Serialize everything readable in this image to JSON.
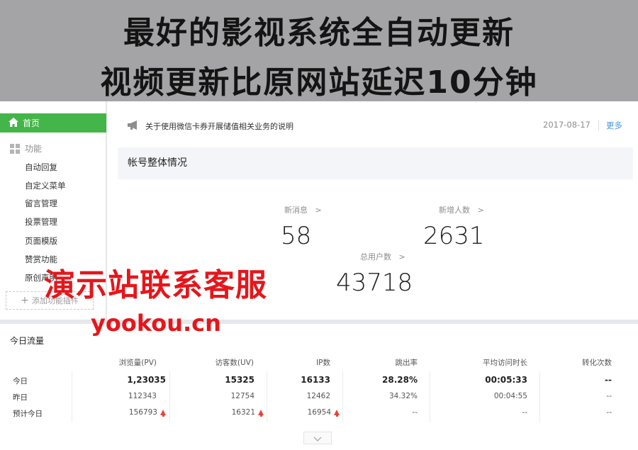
{
  "banner": {
    "line1": "最好的影视系统全自动更新",
    "line2": "视频更新比原网站延迟10分钟"
  },
  "sidebar": {
    "home_label": "首页",
    "section_label": "功能",
    "items": [
      "自动回复",
      "自定义菜单",
      "留言管理",
      "投票管理",
      "页面模版",
      "赞赏功能",
      "原创声明"
    ],
    "add_plugin_label": "添加功能插件"
  },
  "notice": {
    "text": "关于使用微信卡券开展储值相关业务的说明",
    "date": "2017-08-17",
    "more_label": "更多"
  },
  "overview": {
    "title": "帐号整体情况",
    "metrics": [
      {
        "label": "新消息",
        "value": "58"
      },
      {
        "label": "新增人数",
        "value": "2631"
      },
      {
        "label": "总用户数",
        "value": "43718"
      }
    ]
  },
  "watermark": {
    "cn": "演示站联系客服",
    "url": "yookou.cn"
  },
  "traffic": {
    "title": "今日流量",
    "columns": [
      "浏览量(PV)",
      "访客数(UV)",
      "IP数",
      "跳出率",
      "平均访问时长",
      "转化次数"
    ],
    "rows": [
      {
        "label": "今日",
        "cells": [
          "1,23035",
          "15325",
          "16133",
          "28.28%",
          "00:05:33",
          "--"
        ]
      },
      {
        "label": "昨日",
        "cells": [
          "112343",
          "12754",
          "12462",
          "34.32%",
          "00:04:55",
          "--"
        ]
      },
      {
        "label": "预计今日",
        "cells": [
          "156793",
          "16321",
          "16954",
          "--",
          "--",
          "--"
        ]
      }
    ]
  },
  "colors": {
    "accent_green": "#44b549",
    "link_blue": "#459ae9",
    "watermark_red": "#e5161b",
    "up_arrow_red": "#e64340"
  }
}
